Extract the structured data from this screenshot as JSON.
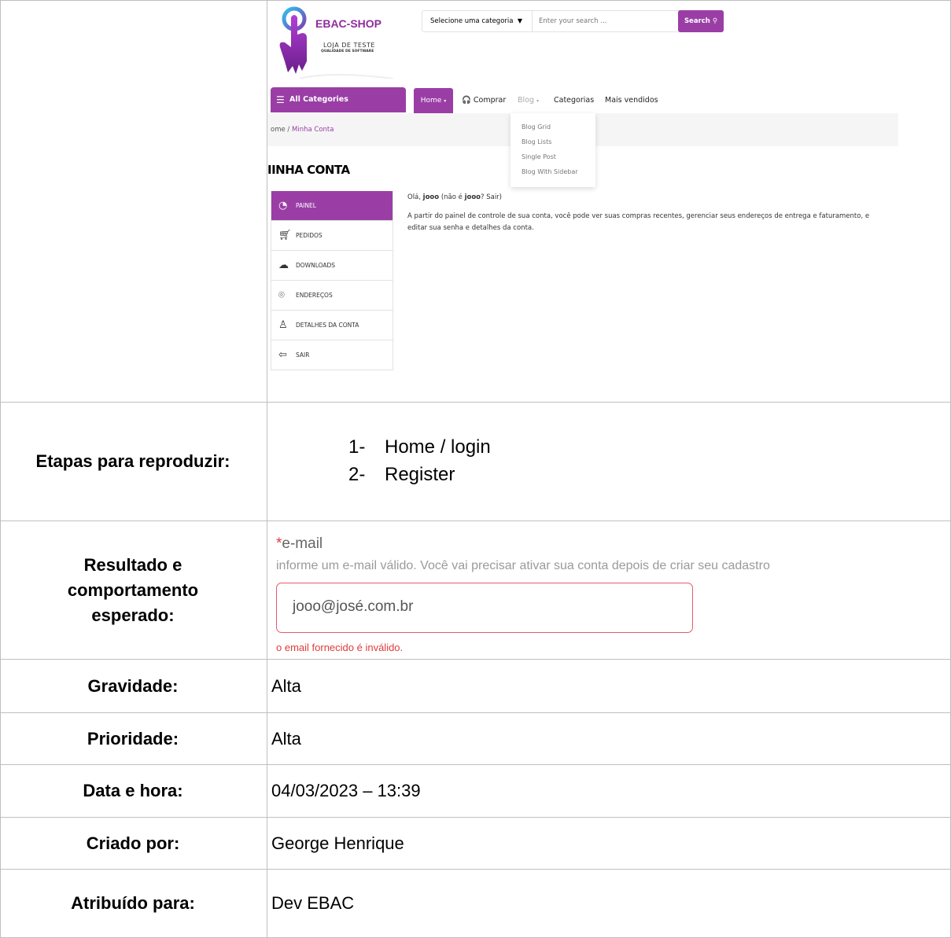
{
  "shop": {
    "brand": "EBAC-SHOP",
    "tagline": "LOJA DE TESTE",
    "tagline_small": "QUALIDADE DE SOFTWARE",
    "category_select": "Selecione uma categoria",
    "search_placeholder": "Enter your search ...",
    "search_button": "Search",
    "all_categories": "All Categories",
    "nav": {
      "home": "Home",
      "comprar": "Comprar",
      "blog": "Blog",
      "categorias": "Categorias",
      "mais_vendidos": "Mais vendidos"
    },
    "blog_menu": [
      "Blog Grid",
      "Blog Lists",
      "Single Post",
      "Blog With Sidebar"
    ],
    "breadcrumb": {
      "home": "ome",
      "separator": "/",
      "current": "Minha Conta"
    },
    "heading": "IINHA CONTA",
    "account_menu": [
      "PAINEL",
      "PEDIDOS",
      "DOWNLOADS",
      "ENDEREÇOS",
      "DETALHES DA CONTA",
      "SAIR"
    ],
    "welcome_prefix": "Olá,",
    "welcome_user": "jooo",
    "welcome_rest": "(não é",
    "welcome_user2": "jooo",
    "welcome_end": "? Sair)",
    "welcome_desc": "A partir do painel de controle de sua conta, você pode ver suas compras recentes, gerenciar seus endereços de entrega e faturamento, e editar sua senha e detalhes da conta."
  },
  "rows": {
    "steps_label": "Etapas para reproduzir:",
    "steps": [
      {
        "num": "1-",
        "text": "Home / login"
      },
      {
        "num": "2-",
        "text": "Register"
      }
    ],
    "expected_label": "Resultado e comportamento esperado:",
    "expected": {
      "field_label": "e-mail",
      "hint": "informe um e-mail válido. Você vai precisar ativar sua conta depois de criar seu cadastro",
      "email_value": "jooo@josé.com.br",
      "error": "o email fornecido é inválido."
    },
    "severity_label": "Gravidade:",
    "severity": "Alta",
    "priority_label": "Prioridade:",
    "priority": "Alta",
    "datetime_label": "Data e hora:",
    "datetime": "04/03/2023 – 13:39",
    "created_label": "Criado por:",
    "created_by": "George Henrique",
    "assigned_label": "Atribuído para:",
    "assigned_to": "Dev EBAC"
  }
}
